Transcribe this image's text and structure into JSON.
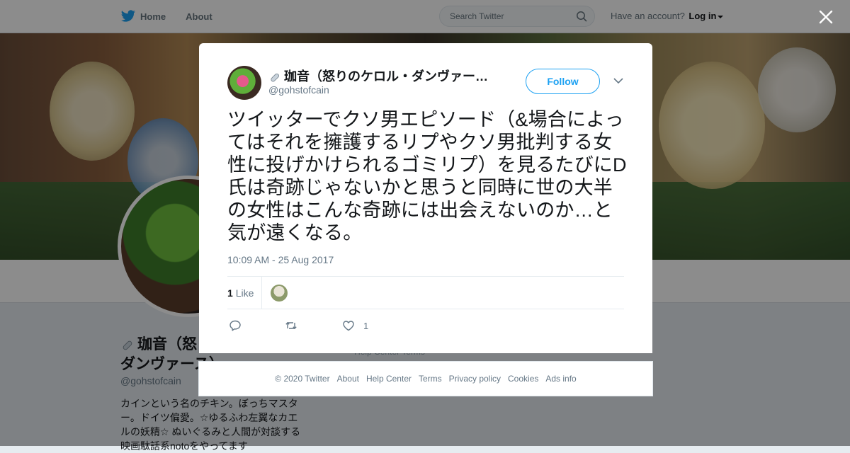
{
  "nav": {
    "home_label": "Home",
    "about_label": "About",
    "search_placeholder": "Search Twitter",
    "account_prompt": "Have an account?",
    "login_label": "Log in"
  },
  "profile": {
    "name": "珈音（怒りのケロル・ダンヴァース）",
    "name_line1": "珈音（怒",
    "name_line2": "ダンヴァース）",
    "handle": "@gohstofcain",
    "bio": "カインという名のチキン。ぼっちマスター。ドイツ偏愛。☆ゆるふわ左翼なカエルの妖精☆ ぬいぐるみと人間が対談する映画駄話系notoをやってます"
  },
  "background_footer": {
    "help_center": "Help Center",
    "terms": "Terms"
  },
  "tweet": {
    "author_name": "珈音（怒りのケロル・ダンヴァー…",
    "author_handle": "@gohstofcain",
    "follow_label": "Follow",
    "text": "ツイッターでクソ男エピソード（&場合によってはそれを擁護するリプやクソ男批判する女性に投げかけられるゴミリプ）を見るたびにD氏は奇跡じゃないかと思うと同時に世の大半の女性はこんな奇跡には出会えないのか…と気が遠くなる。",
    "timestamp": "10:09 AM - 25 Aug 2017",
    "likes_count": "1",
    "likes_label": "Like",
    "like_action_count": "1"
  },
  "footer": {
    "copyright": "© 2020 Twitter",
    "links": [
      "About",
      "Help Center",
      "Terms",
      "Privacy policy",
      "Cookies",
      "Ads info"
    ]
  },
  "colors": {
    "accent": "#1da1f2",
    "overlay": "rgba(0,0,0,0.45)"
  },
  "icons": [
    "twitter-bird-icon",
    "search-icon",
    "close-icon",
    "chevron-down-icon",
    "reply-icon",
    "retweet-icon",
    "heart-icon",
    "key-icon"
  ]
}
